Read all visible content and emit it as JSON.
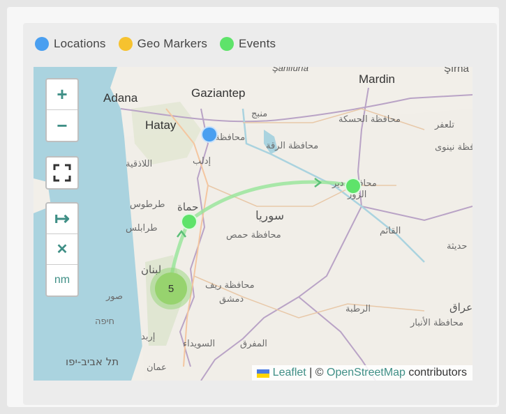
{
  "legend": [
    {
      "label": "Locations",
      "color": "#4a9ff0"
    },
    {
      "label": "Geo Markers",
      "color": "#f6c22f"
    },
    {
      "label": "Events",
      "color": "#5ee36a"
    }
  ],
  "controls": {
    "zoom_in": "+",
    "zoom_out": "−",
    "fullscreen": "⛶",
    "route": "↦",
    "clear": "✕",
    "units": "nm"
  },
  "cluster": {
    "count": "5"
  },
  "attribution": {
    "leaflet": "Leaflet",
    "sep": " | © ",
    "osm": "OpenStreetMap",
    "suffix": " contributors"
  },
  "map_labels": {
    "gaziantep": "Gaziantep",
    "adana": "Adana",
    "hatay": "Hatay",
    "mardin": "Mardin",
    "sanliurfa": "Şanlıurfa",
    "sirnak": "Şırna",
    "manbij": "منبج",
    "hasakah_gov": "محافظة الحسكة",
    "aleppo_gov": "محافظة",
    "raqqa_gov": "محافظة الرقة",
    "latakia": "اللاذقية",
    "idlib": "إدلب",
    "tartus": "طرطوس",
    "hama": "حماة",
    "tripoli": "طرابلس",
    "syria": "سوريا",
    "homs_gov": "محافظة حمص",
    "deir_gov": "محافظة دير",
    "deir": "الزور",
    "qaim": "القائم",
    "haditha": "حديثة",
    "talafar": "تلعفر",
    "nineveh": "محافظة نينوى",
    "lebanon": "لبنان",
    "rif_dimashq": "محافظة ريف",
    "dimashq": "دمشق",
    "tyre": "صور",
    "rutba": "الرطبة",
    "iraq": "عراق",
    "anbar": "محافظة الأنبار",
    "haifa": "חיפה",
    "irbid": "إربد",
    "suwayda": "السويداء",
    "mafraq": "المفرق",
    "tel_aviv": "תל אביב-יפו",
    "amman": "عمان"
  }
}
